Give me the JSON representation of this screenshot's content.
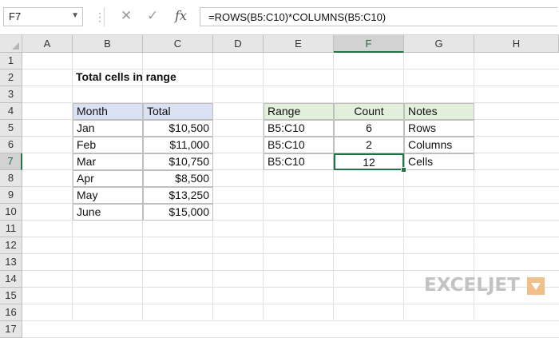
{
  "formula_bar": {
    "name_box": "F7",
    "formula": "=ROWS(B5:C10)*COLUMNS(B5:C10)",
    "cancel_icon": "✕",
    "enter_icon": "✓",
    "fx_icon": "fx",
    "dots_icon": "⋮"
  },
  "columns": [
    "A",
    "B",
    "C",
    "D",
    "E",
    "F",
    "G",
    "H"
  ],
  "rows": [
    "1",
    "2",
    "3",
    "4",
    "5",
    "6",
    "7",
    "8",
    "9",
    "10",
    "11",
    "12",
    "13",
    "14",
    "15",
    "16",
    "17"
  ],
  "selected": {
    "column": "F",
    "row": "7"
  },
  "sheet": {
    "title": "Total cells in range",
    "data_table": {
      "headers": [
        "Month",
        "Total"
      ],
      "rows": [
        [
          "Jan",
          "$10,500"
        ],
        [
          "Feb",
          "$11,000"
        ],
        [
          "Mar",
          "$10,750"
        ],
        [
          "Apr",
          "$8,500"
        ],
        [
          "May",
          "$13,250"
        ],
        [
          "June",
          "$15,000"
        ]
      ]
    },
    "result_table": {
      "headers": [
        "Range",
        "Count",
        "Notes"
      ],
      "rows": [
        [
          "B5:C10",
          "6",
          "Rows"
        ],
        [
          "B5:C10",
          "2",
          "Columns"
        ],
        [
          "B5:C10",
          "12",
          "Cells"
        ]
      ]
    }
  },
  "branding": {
    "logo_text": "EXCELJET"
  },
  "colors": {
    "accent": "#217346",
    "data_header_fill": "#d9e1f2",
    "result_header_fill": "#e2efda"
  }
}
